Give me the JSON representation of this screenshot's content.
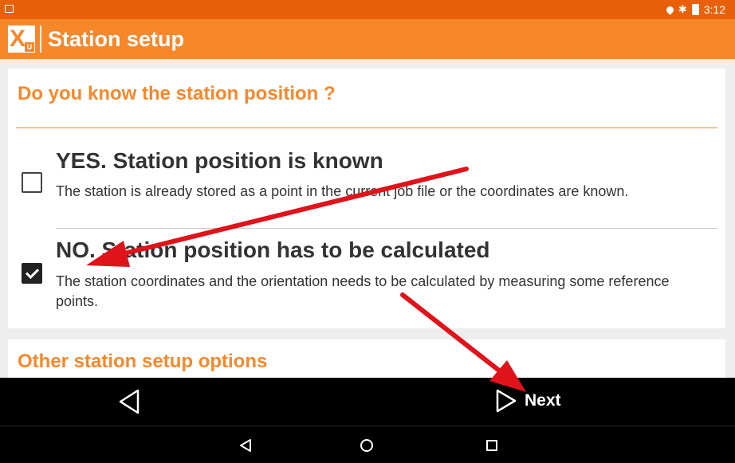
{
  "status_bar": {
    "time": "3:12"
  },
  "app_bar": {
    "title": "Station setup"
  },
  "section1": {
    "title": "Do you know the station position ?",
    "options": [
      {
        "title": "YES. Station position is known",
        "description": "The station is already stored as a point in the current job file or the coordinates are known.",
        "checked": false
      },
      {
        "title": "NO. Station position has to be calculated",
        "description": "The station coordinates and the orientation needs to be calculated by measuring some reference points.",
        "checked": true
      }
    ]
  },
  "section2": {
    "title": "Other station setup options"
  },
  "nav": {
    "next_label": "Next"
  },
  "colors": {
    "status_bar": "#e8610a",
    "app_bar": "#f6882a",
    "accent": "#f6882a",
    "annotation_arrow": "#e0131a"
  }
}
